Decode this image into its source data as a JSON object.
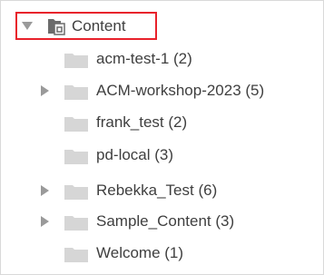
{
  "tree": {
    "root": {
      "label": "Content",
      "expanded": true,
      "icon": "content-library-icon"
    },
    "children": [
      {
        "label": "acm-test-1 (2)",
        "has_children": false,
        "icon": "folder-icon"
      },
      {
        "label": "ACM-workshop-2023 (5)",
        "has_children": true,
        "icon": "folder-icon"
      },
      {
        "label": "frank_test (2)",
        "has_children": false,
        "icon": "folder-icon"
      },
      {
        "label": "pd-local (3)",
        "has_children": false,
        "icon": "folder-icon"
      },
      {
        "label": "Rebekka_Test (6)",
        "has_children": true,
        "icon": "folder-icon"
      },
      {
        "label": "Sample_Content (3)",
        "has_children": true,
        "icon": "folder-icon"
      },
      {
        "label": "Welcome (1)",
        "has_children": false,
        "icon": "folder-icon"
      }
    ]
  },
  "colors": {
    "highlight_border": "#e8212b",
    "folder_fill": "#d6d6d6",
    "toggle_fill": "#9a9a9a",
    "text": "#3f3f3f"
  }
}
